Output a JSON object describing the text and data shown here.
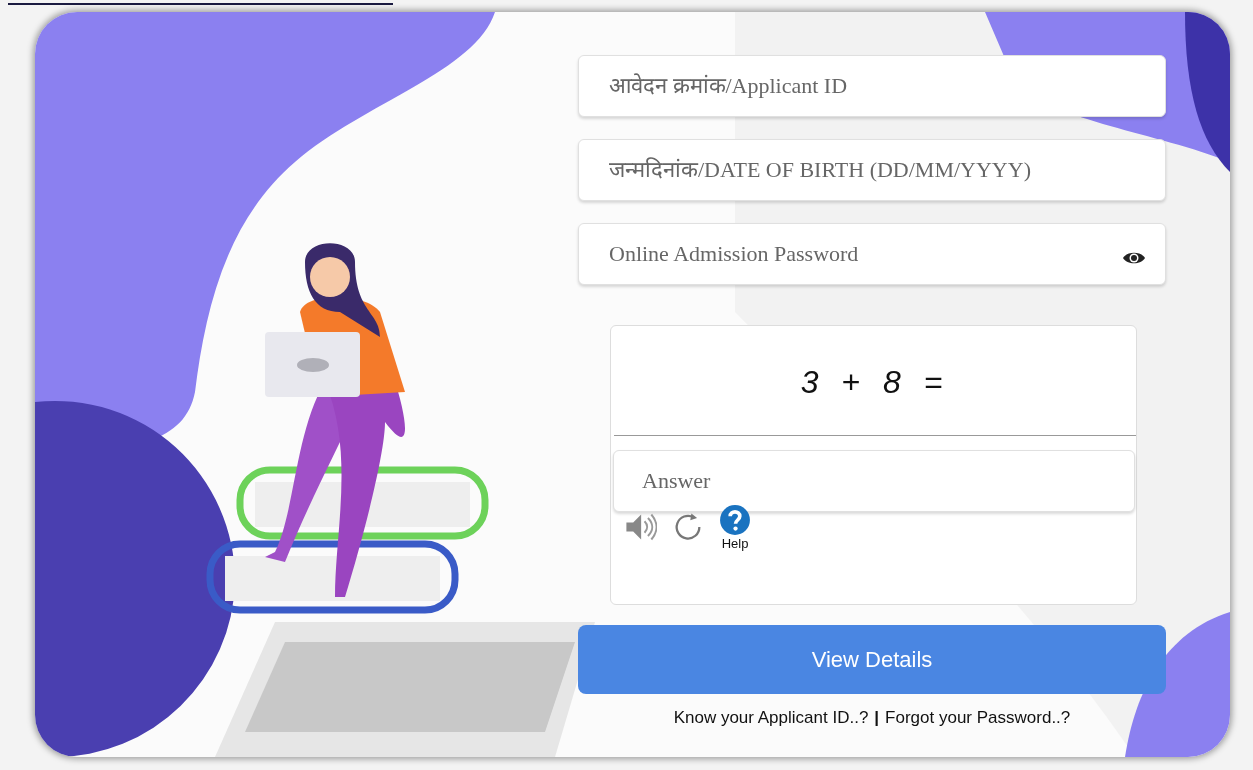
{
  "fields": [
    {
      "kind": "text",
      "placeholder": "आवेदन क्रमांक/Applicant ID"
    },
    {
      "kind": "text",
      "placeholder": "जन्मदिनांक/DATE OF BIRTH (DD/MM/YYYY)"
    },
    {
      "kind": "password",
      "placeholder": "Online Admission Password"
    }
  ],
  "captcha": {
    "question": "3 + 8 =",
    "answer_placeholder": "Answer",
    "help_label": "Help"
  },
  "submit_button": "View Details",
  "links": [
    "Know your Applicant ID..?",
    "Forgot your Password..?"
  ],
  "separator": "|"
}
